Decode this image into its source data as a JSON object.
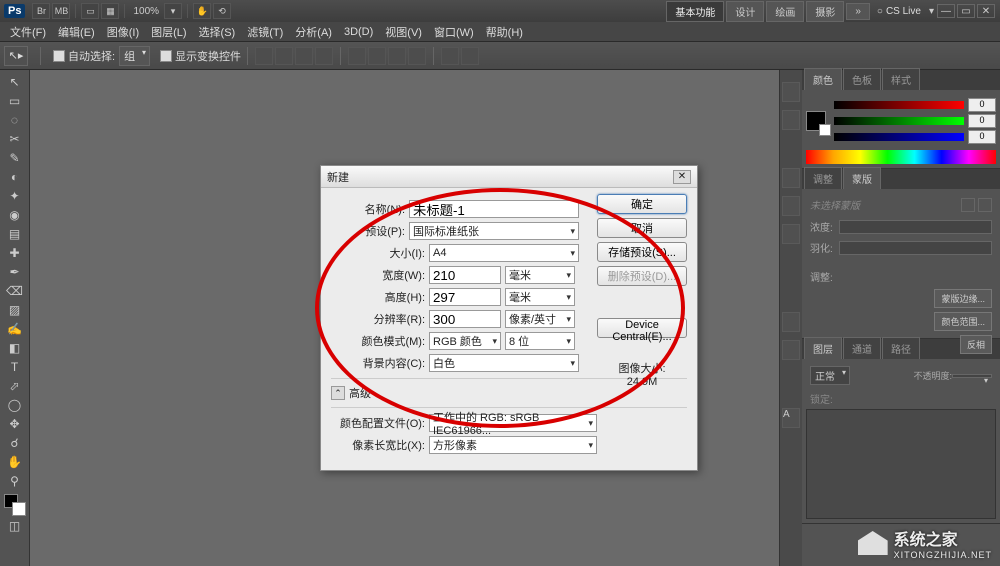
{
  "titlebar": {
    "ps": "Ps",
    "zoom": "100%",
    "workspace_buttons": [
      "基本功能",
      "设计",
      "绘画",
      "摄影"
    ],
    "cslive": "CS Live"
  },
  "menubar": [
    "文件(F)",
    "编辑(E)",
    "图像(I)",
    "图层(L)",
    "选择(S)",
    "滤镜(T)",
    "分析(A)",
    "3D(D)",
    "视图(V)",
    "窗口(W)",
    "帮助(H)"
  ],
  "optbar": {
    "auto_select": "自动选择:",
    "group": "组",
    "show_transform": "显示变换控件"
  },
  "dock": {
    "color_tabs": [
      "颜色",
      "色板",
      "样式"
    ],
    "rgb_vals": [
      "0",
      "0",
      "0"
    ],
    "adjust_tabs": [
      "调整",
      "蒙版"
    ],
    "mask_placeholder": "未选择蒙版",
    "density": "浓度:",
    "feather": "羽化:",
    "refine": "调整:",
    "mask_edge": "蒙版边缘...",
    "color_range": "颜色范围...",
    "invert": "反相",
    "layer_tabs": [
      "图层",
      "通道",
      "路径"
    ],
    "blend_mode": "正常",
    "opacity_lbl": "不透明度:",
    "lock_lbl": "锁定:"
  },
  "dialog": {
    "title": "新建",
    "name_lbl": "名称(N):",
    "name_val": "未标题-1",
    "preset_lbl": "预设(P):",
    "preset_val": "国际标准纸张",
    "size_lbl": "大小(I):",
    "size_val": "A4",
    "width_lbl": "宽度(W):",
    "width_val": "210",
    "width_unit": "毫米",
    "height_lbl": "高度(H):",
    "height_val": "297",
    "height_unit": "毫米",
    "res_lbl": "分辨率(R):",
    "res_val": "300",
    "res_unit": "像素/英寸",
    "mode_lbl": "颜色模式(M):",
    "mode_val": "RGB 颜色",
    "bit_val": "8 位",
    "bg_lbl": "背景内容(C):",
    "bg_val": "白色",
    "advanced": "高级",
    "profile_lbl": "颜色配置文件(O):",
    "profile_val": "工作中的 RGB: sRGB IEC61966...",
    "aspect_lbl": "像素长宽比(X):",
    "aspect_val": "方形像素",
    "ok": "确定",
    "cancel": "取消",
    "save_preset": "存储预设(S)...",
    "delete_preset": "删除预设(D)...",
    "device_central": "Device Central(E)...",
    "imgsize_lbl": "图像大小:",
    "imgsize_val": "24.9M"
  },
  "watermark": {
    "name": "系统之家",
    "url": "XITONGZHIJIA.NET"
  },
  "tool_icons": [
    "↖",
    "▭",
    "◌",
    "✂",
    "✎",
    "◐",
    "✦",
    "◉",
    "▤",
    "✚",
    "✒",
    "⌫",
    "▨",
    "✍",
    "◧",
    "⬚",
    "T",
    "⬀",
    "◯",
    "✥",
    "☌",
    "✋",
    "⚲",
    "◫"
  ]
}
